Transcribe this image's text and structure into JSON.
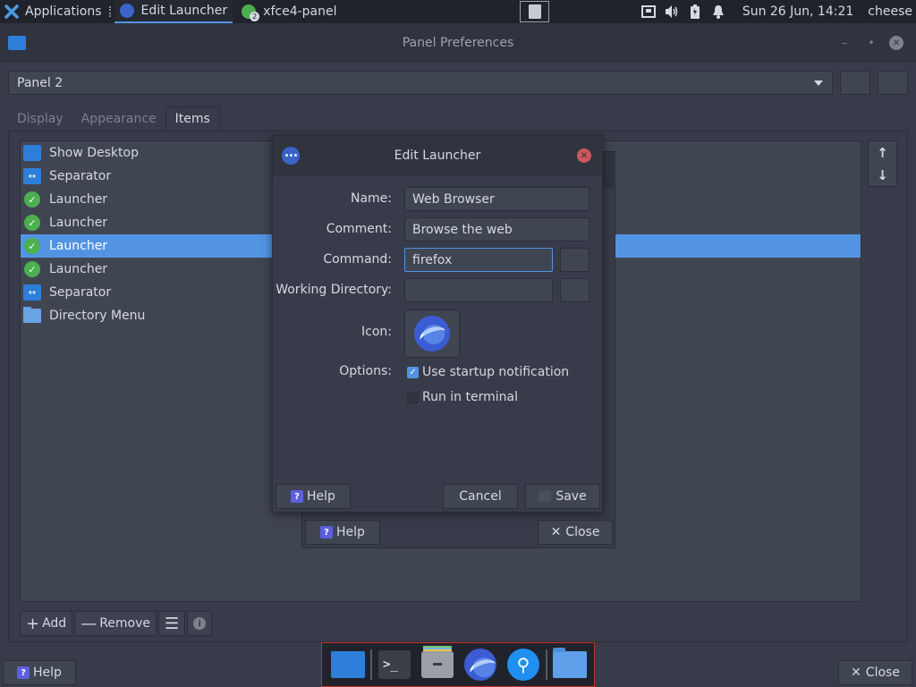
{
  "top_panel": {
    "applications_label": "Applications",
    "tasks": [
      {
        "label": "Edit Launcher",
        "active": true
      },
      {
        "label": "xfce4-panel",
        "badge": "2",
        "active": false
      }
    ],
    "clock": "Sun 26 Jun, 14:21",
    "user": "cheese"
  },
  "prefs": {
    "title": "Panel Preferences",
    "panel_selected": "Panel 2",
    "tabs": [
      "Display",
      "Appearance",
      "Items"
    ],
    "active_tab": "Items",
    "items": [
      {
        "label": "Show Desktop",
        "icon": "desktop-icon"
      },
      {
        "label": "Separator",
        "icon": "separator-icon"
      },
      {
        "label": "Launcher",
        "icon": "launcher-icon"
      },
      {
        "label": "Launcher",
        "icon": "launcher-icon"
      },
      {
        "label": "Launcher",
        "icon": "launcher-icon",
        "selected": true
      },
      {
        "label": "Launcher",
        "icon": "launcher-icon"
      },
      {
        "label": "Separator",
        "icon": "separator-icon"
      },
      {
        "label": "Directory Menu",
        "icon": "folder-icon"
      }
    ],
    "toolbar": {
      "add": "Add",
      "remove": "Remove"
    },
    "help": "Help",
    "close": "Close"
  },
  "under_dialog": {
    "help": "Help",
    "close": "Close"
  },
  "edit_launcher": {
    "title": "Edit Launcher",
    "labels": {
      "name": "Name:",
      "comment": "Comment:",
      "command": "Command:",
      "working_dir": "Working Directory:",
      "icon": "Icon:",
      "options": "Options:"
    },
    "values": {
      "name": "Web Browser",
      "comment": "Browse the web",
      "command": "firefox",
      "working_dir": ""
    },
    "options": [
      {
        "label": "Use startup notification",
        "checked": true
      },
      {
        "label": "Run in terminal",
        "checked": false
      }
    ],
    "help": "Help",
    "cancel": "Cancel",
    "save": "Save"
  },
  "dock": {
    "items": [
      "desktop-icon",
      "terminal-icon",
      "file-manager-icon",
      "web-browser-icon",
      "search-icon",
      "folder-icon"
    ]
  },
  "colors": {
    "accent": "#5294e2",
    "window_bg": "#383c4a",
    "titlebar_bg": "#2f343f",
    "close_red": "#cc575d"
  }
}
